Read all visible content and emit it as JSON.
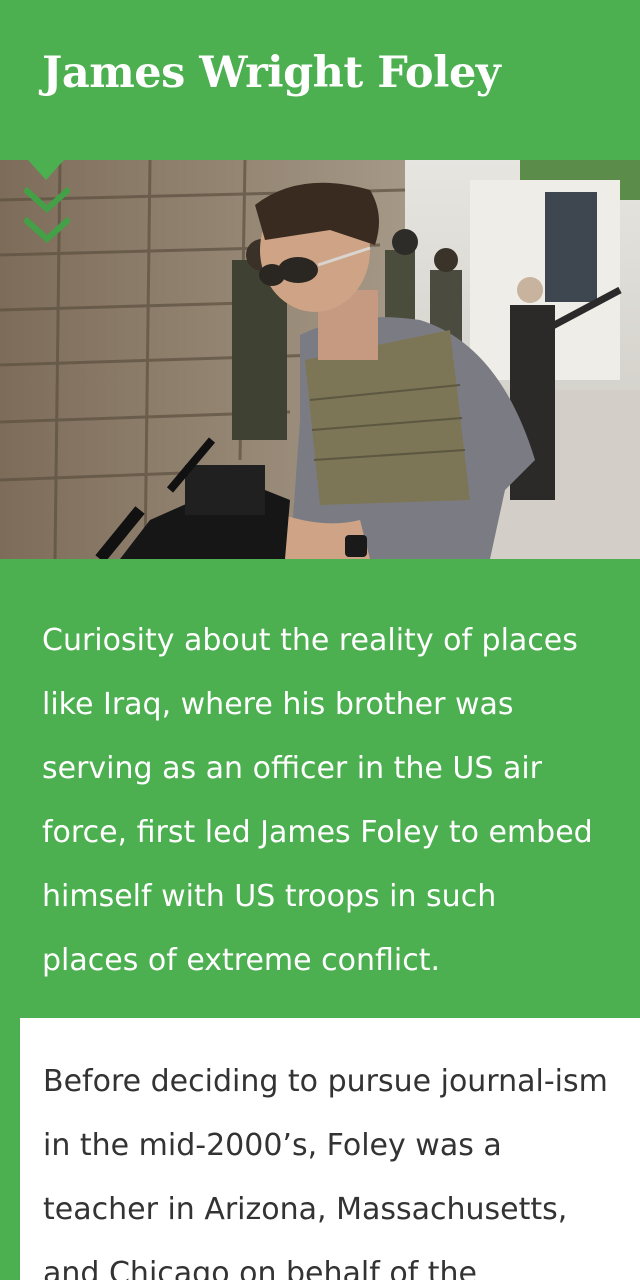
{
  "article": {
    "title": "James Wright Foley",
    "photo_label": "Photo of James Wright Foley with camera and body armor",
    "scroll_icon": "double-chevron-down-icon",
    "intro": "Curiosity about the reality of places like Iraq, where his brother was serving as an officer in the US air force, first led James Foley to embed himself with US troops in such places of extreme conflict.",
    "body": "Before deciding to pursue journal-ism in the mid-2000’s, Foley was a teacher in Arizona, Massachusetts, and Chicago on behalf of the"
  },
  "colors": {
    "brand_green": "#4CAF50",
    "chevron_green": "#43A047",
    "text_white": "#ffffff",
    "text_dark": "#333333"
  }
}
